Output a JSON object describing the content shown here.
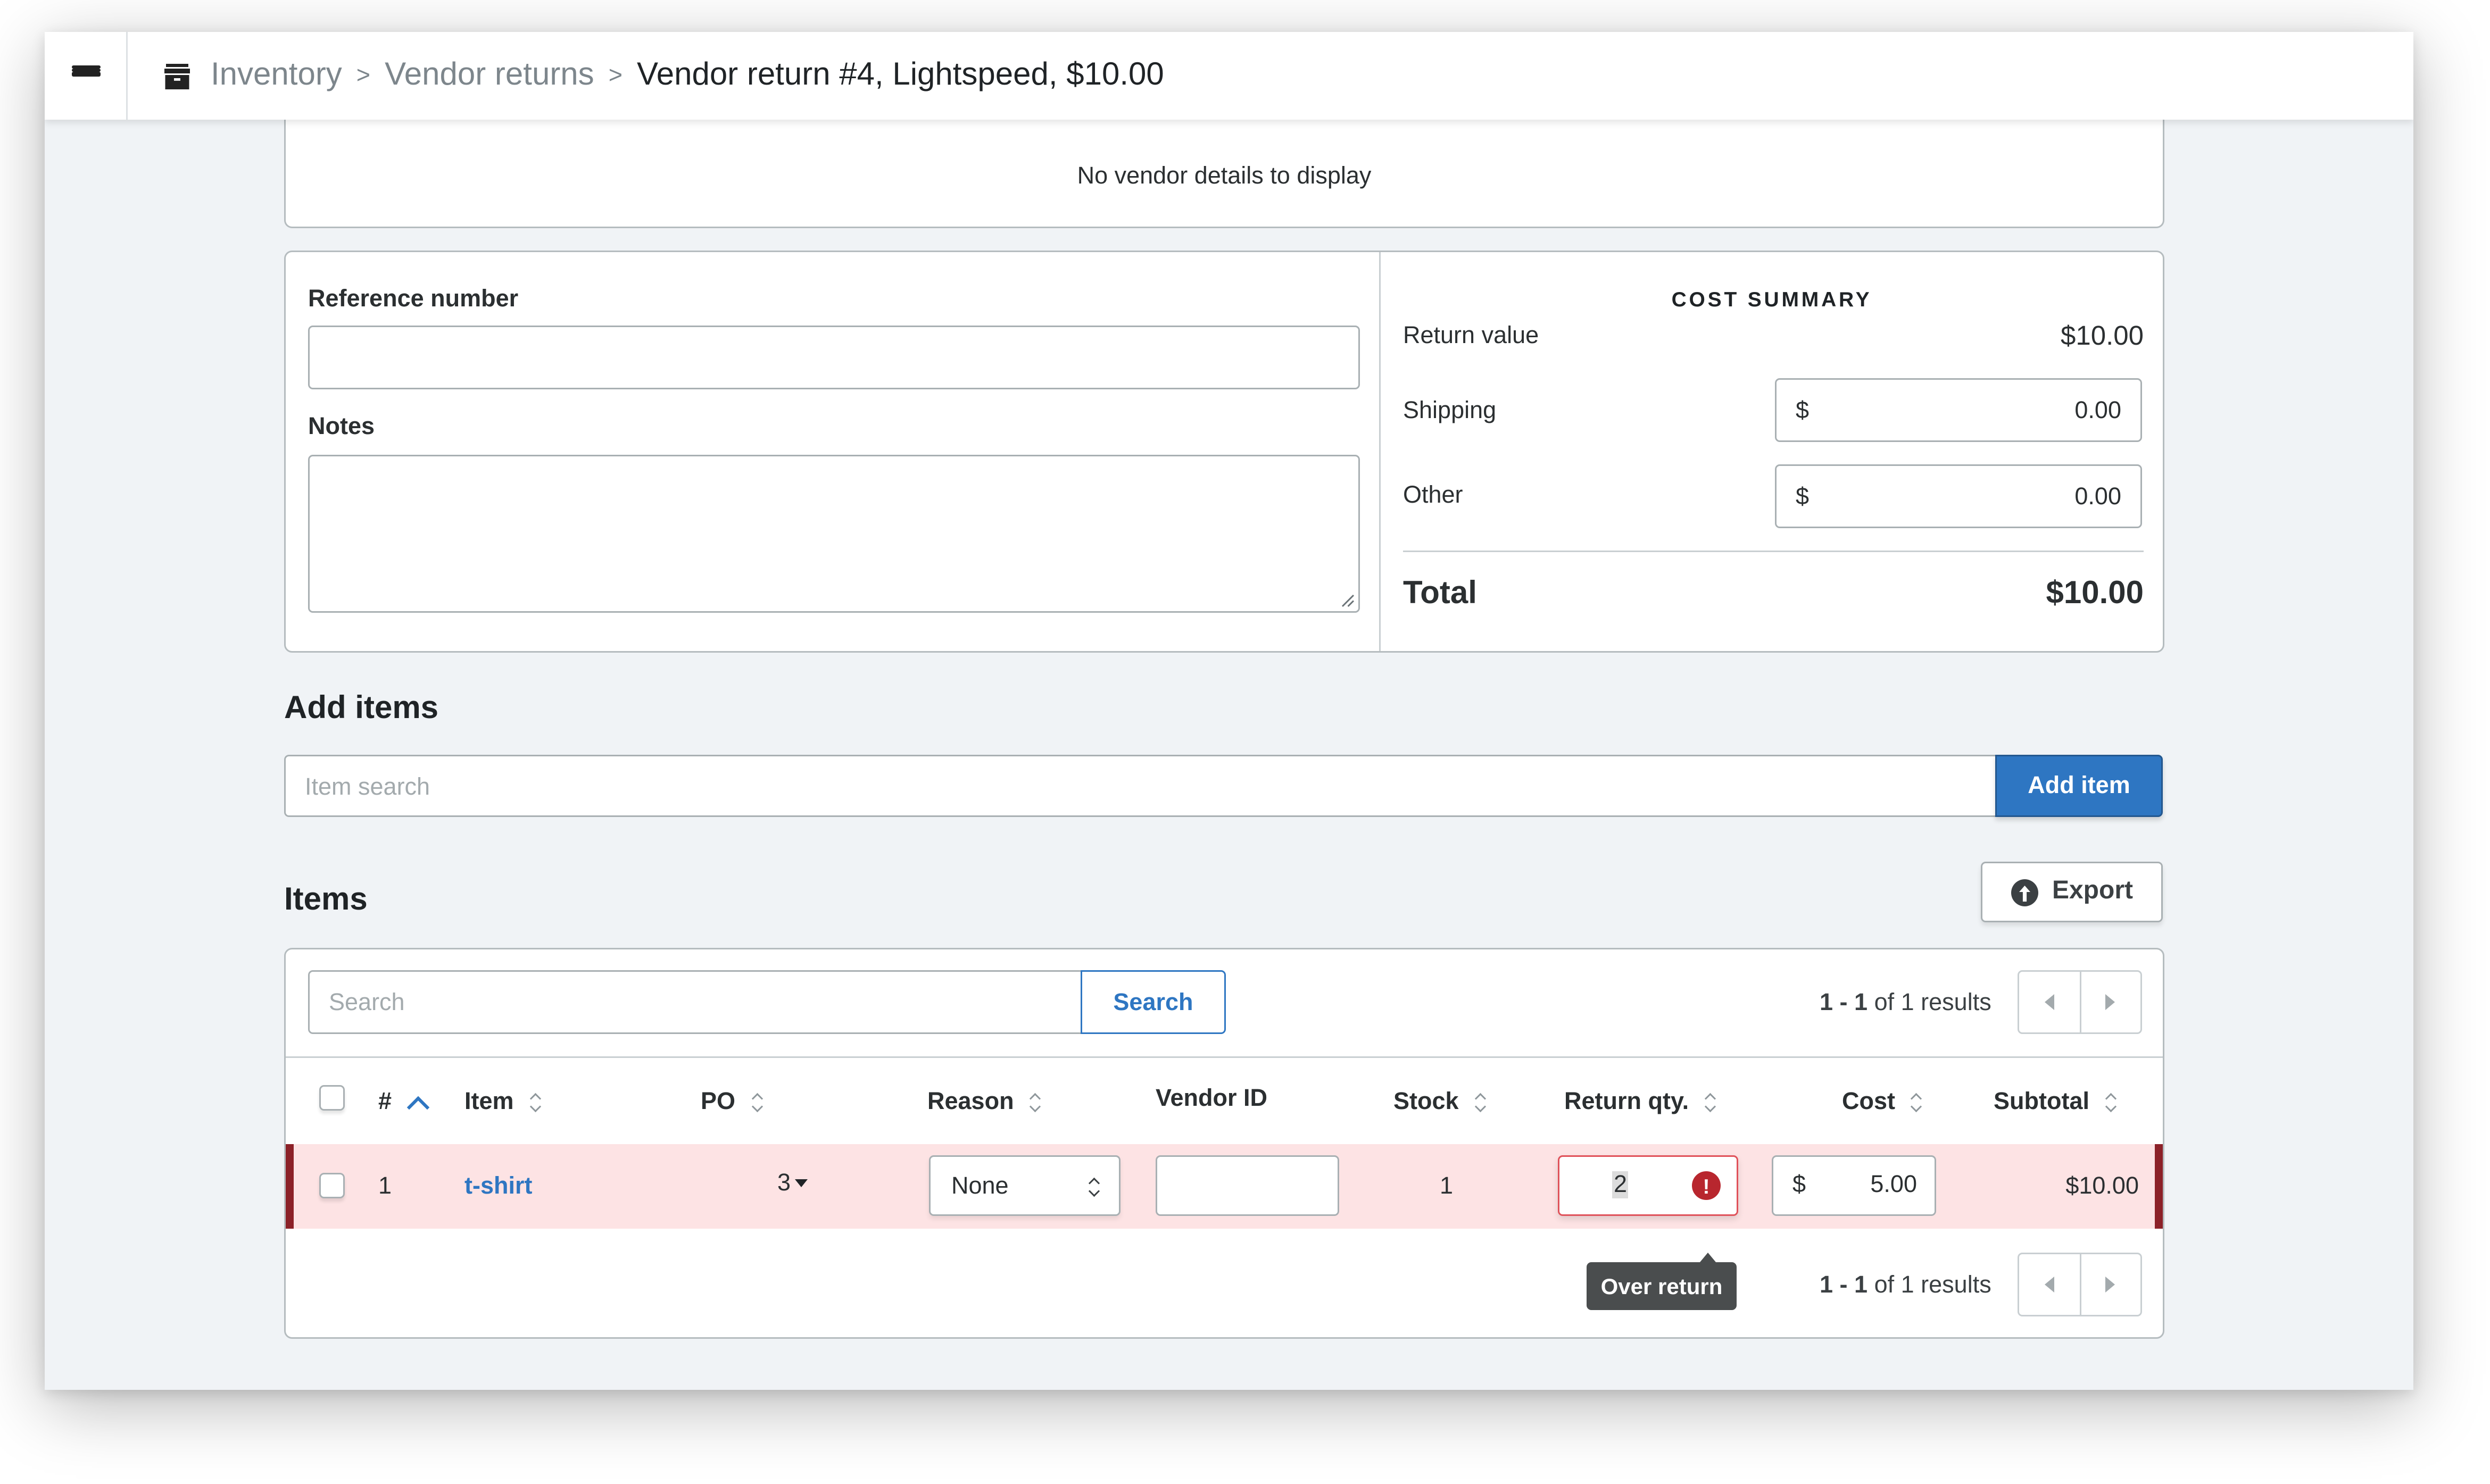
{
  "header": {
    "menu_icon": "hamburger-menu-icon",
    "section_icon": "inventory-box-icon",
    "breadcrumb": [
      {
        "label": "Inventory"
      },
      {
        "label": "Vendor returns"
      }
    ],
    "separator": ">",
    "current": "Vendor return #4, Lightspeed, $10.00"
  },
  "vendor": {
    "message": "No vendor details to display"
  },
  "details": {
    "reference_label": "Reference number",
    "reference_value": "",
    "notes_label": "Notes",
    "notes_value": ""
  },
  "cost_summary": {
    "title": "COST SUMMARY",
    "return_value_label": "Return value",
    "return_value": "$10.00",
    "shipping_label": "Shipping",
    "shipping_currency": "$",
    "shipping_value": "0.00",
    "other_label": "Other",
    "other_currency": "$",
    "other_value": "0.00",
    "total_label": "Total",
    "total_value": "$10.00"
  },
  "add_items": {
    "title": "Add items",
    "search_placeholder": "Item search",
    "add_button": "Add item"
  },
  "items": {
    "title": "Items",
    "export_button": "Export",
    "export_icon": "upload-circle-icon",
    "search_placeholder": "Search",
    "search_button": "Search",
    "results_range": "1 - 1",
    "results_of": "of",
    "results_total": "1",
    "results_suffix": "results",
    "columns": [
      "#",
      "Item",
      "PO",
      "Reason",
      "Vendor ID",
      "Stock",
      "Return qty.",
      "Cost",
      "Subtotal"
    ],
    "sorted_column": "#",
    "sort_direction": "ascending",
    "rows": [
      {
        "number": "1",
        "item": "t-shirt",
        "po": "3",
        "reason": "None",
        "vendor_id": "",
        "stock": "1",
        "return_qty": "2",
        "cost_currency": "$",
        "cost": "5.00",
        "subtotal": "$10.00",
        "error": true,
        "error_tooltip": "Over return",
        "error_icon": "exclamation-circle-icon"
      }
    ]
  },
  "colors": {
    "accent": "#2e76c2",
    "error_row_bg": "#fde3e4",
    "error_row_border": "#8c2128",
    "error_icon": "#b8262e",
    "tooltip_bg": "#4a4d4e",
    "page_bg": "#f0f3f6"
  }
}
